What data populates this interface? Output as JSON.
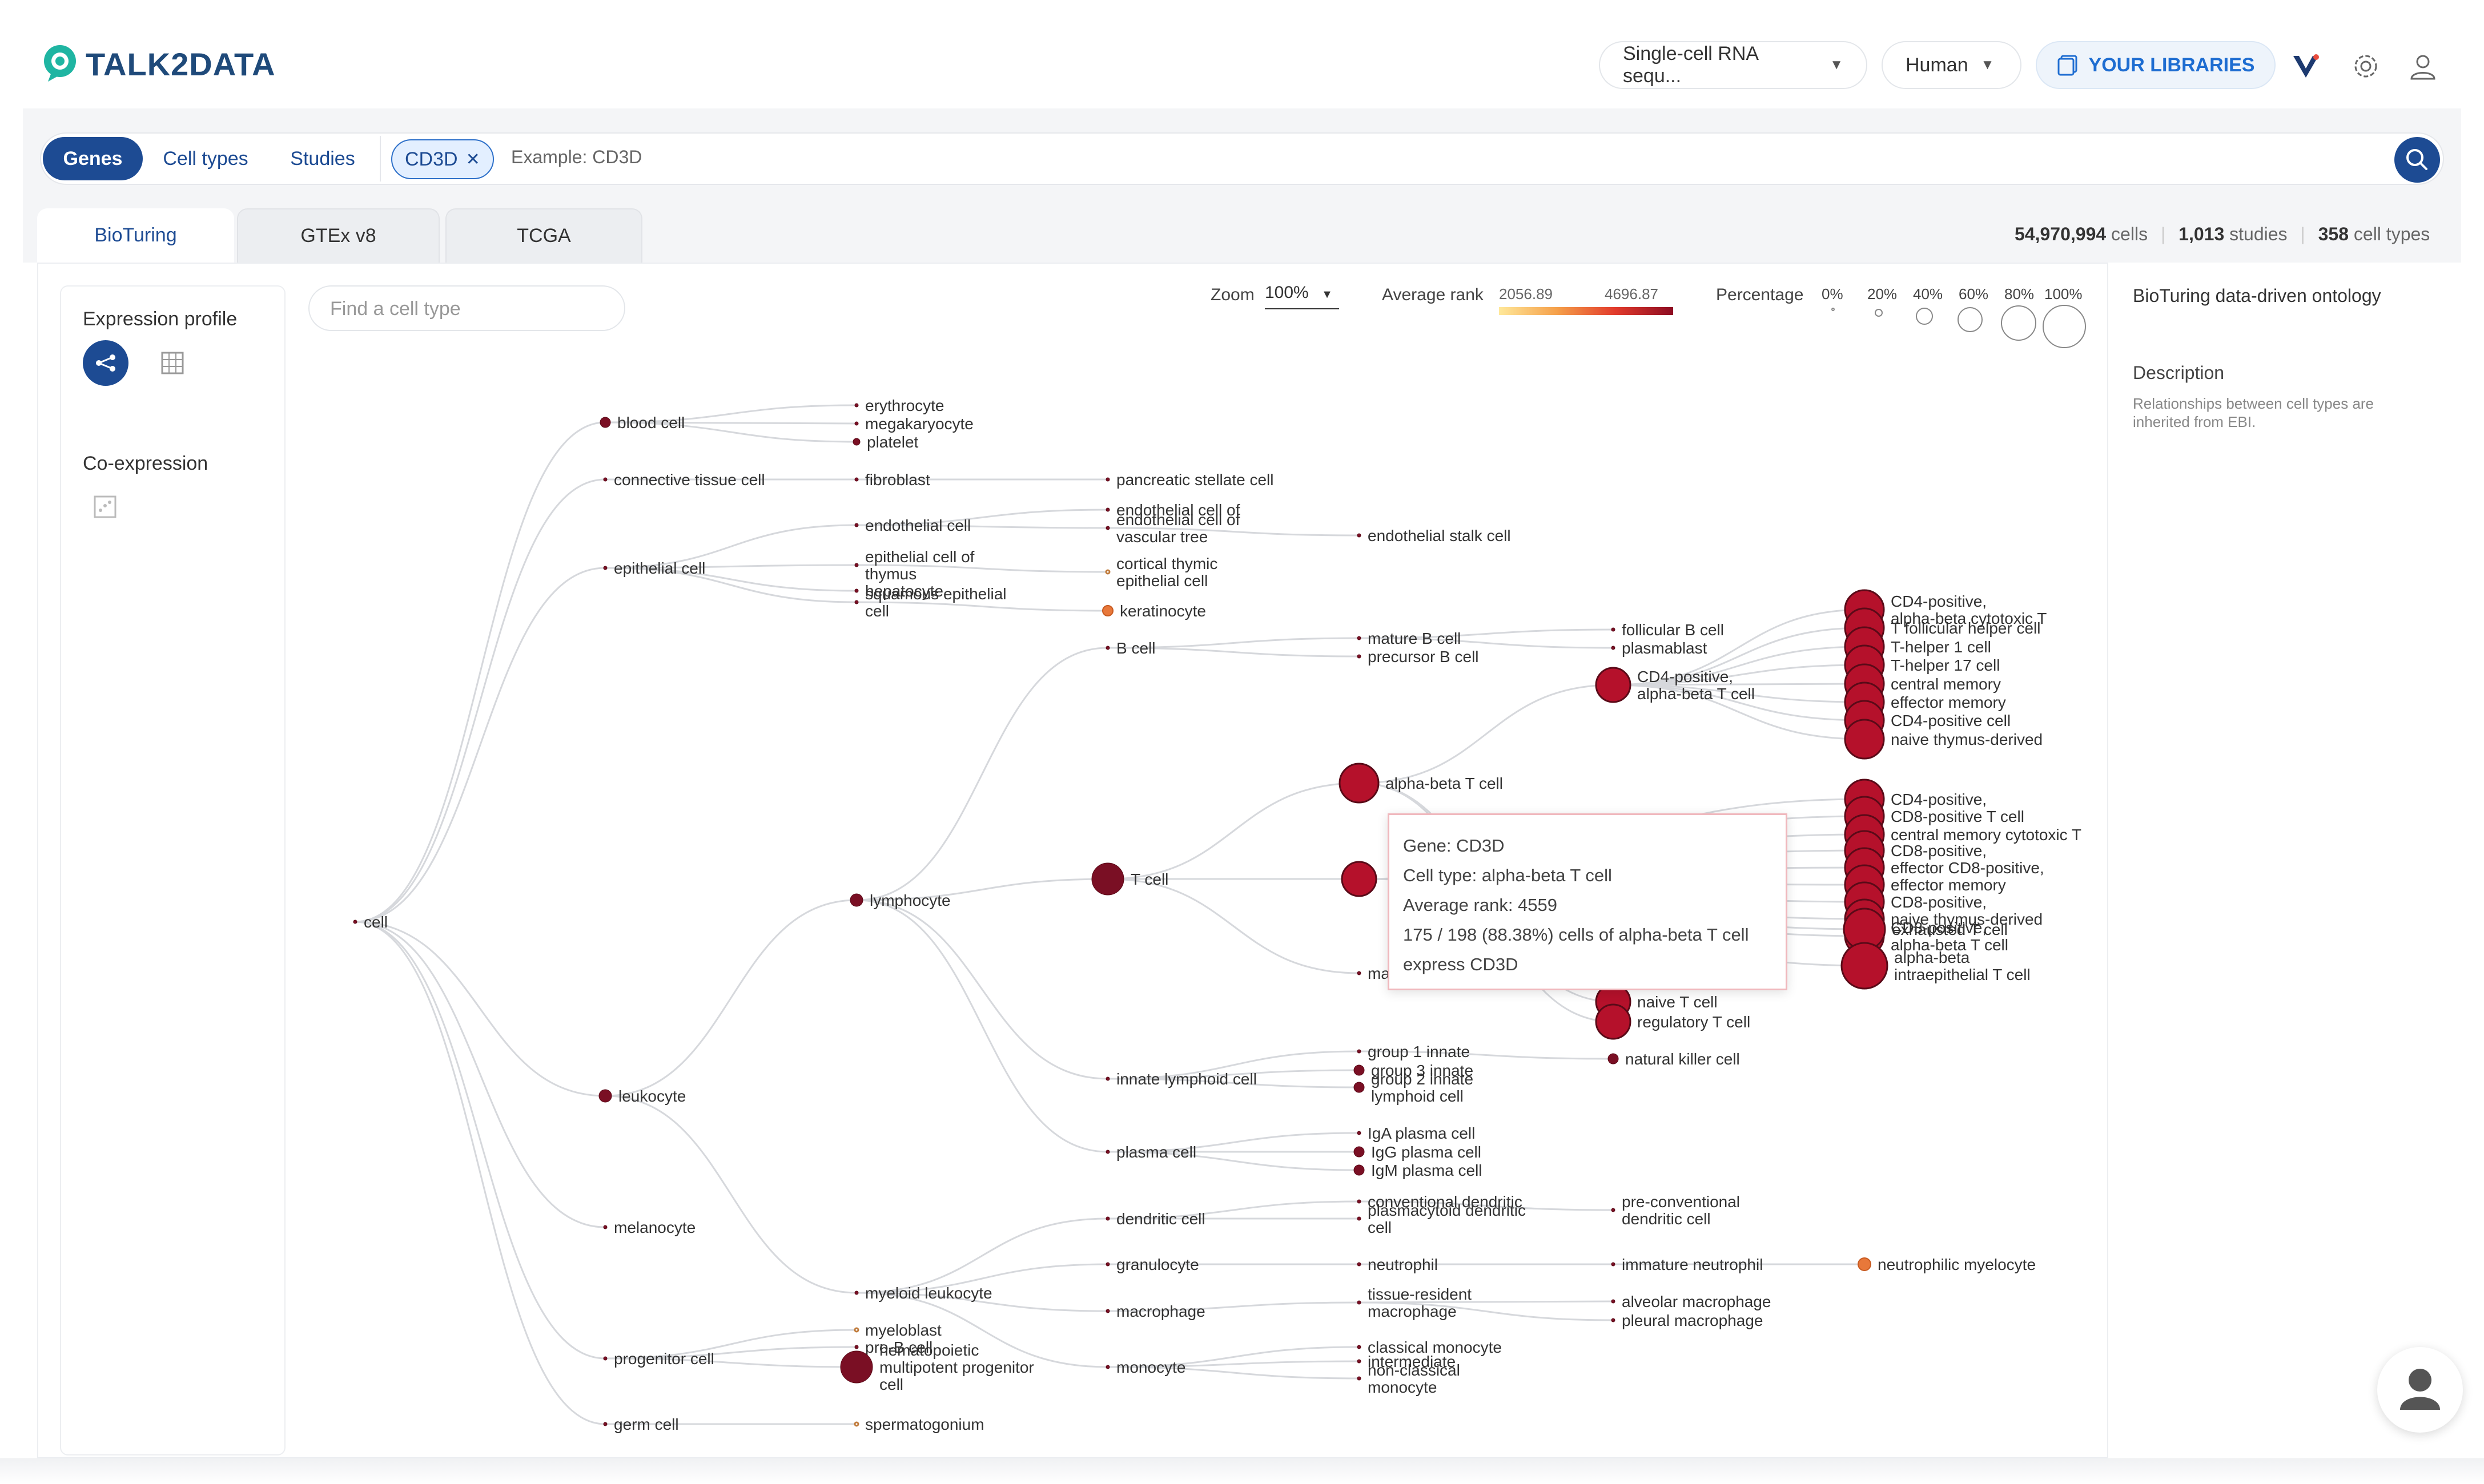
{
  "header": {
    "logo_text": "TALK2DATA",
    "dataset_select": "Single-cell RNA sequ...",
    "species_select": "Human",
    "libraries_label": "YOUR LIBRARIES"
  },
  "search": {
    "tabs": [
      "Genes",
      "Cell types",
      "Studies"
    ],
    "active_tab": "Genes",
    "chip": "CD3D",
    "placeholder": "Example: CD3D"
  },
  "source_tabs": [
    "BioTuring",
    "GTEx v8",
    "TCGA"
  ],
  "stats": {
    "cells": "54,970,994",
    "cells_label": "cells",
    "studies": "1,013",
    "studies_label": "studies",
    "cell_types": "358",
    "cell_types_label": "cell types"
  },
  "left_panel": {
    "expression_profile": "Expression profile",
    "co_expression": "Co-expression"
  },
  "tree_panel": {
    "find_placeholder": "Find a cell type",
    "zoom_label": "Zoom",
    "zoom_value": "100%",
    "avg_rank_label": "Average rank",
    "avg_rank_min": "2056.89",
    "avg_rank_max": "4696.87",
    "percentage_label": "Percentage",
    "percentage_ticks": [
      "0%",
      "20%",
      "40%",
      "60%",
      "80%",
      "100%"
    ]
  },
  "right_panel": {
    "title": "BioTuring data-driven ontology",
    "description_label": "Description",
    "description_line1": "Relationships between cell types are",
    "description_line2": "inherited from EBI."
  },
  "tooltip": {
    "gene": "Gene: CD3D",
    "cell_type": "Cell type: alpha-beta T cell",
    "avg_rank": "Average rank: 4559",
    "cells_line1": "175 / 198 (88.38%) cells of alpha-beta T cell",
    "cells_line2": "express CD3D"
  },
  "colors": {
    "brand_blue": "#1d4b93",
    "accent_teal": "#1fb5a2",
    "node_dark": "#7a0f24",
    "node_red": "#b5112b",
    "node_orange": "#e8783a"
  },
  "tree": {
    "nodes": [
      {
        "id": "cell",
        "labels": [
          "cell"
        ],
        "r": 3
      },
      {
        "id": "blood",
        "labels": [
          "blood cell"
        ],
        "r": 9
      },
      {
        "id": "conn",
        "labels": [
          "connective tissue cell"
        ],
        "r": 3
      },
      {
        "id": "epi",
        "labels": [
          "epithelial cell"
        ],
        "r": 3
      },
      {
        "id": "leuk",
        "labels": [
          "leukocyte"
        ],
        "r": 11
      },
      {
        "id": "mela",
        "labels": [
          "melanocyte"
        ],
        "r": 3
      },
      {
        "id": "prog",
        "labels": [
          "progenitor cell"
        ],
        "r": 3
      },
      {
        "id": "germ",
        "labels": [
          "germ cell"
        ],
        "r": 3
      },
      {
        "id": "ery",
        "labels": [
          "erythrocyte"
        ],
        "r": 3
      },
      {
        "id": "mega",
        "labels": [
          "megakaryocyte"
        ],
        "r": 3
      },
      {
        "id": "plt",
        "labels": [
          "platelet"
        ],
        "r": 6
      },
      {
        "id": "fib",
        "labels": [
          "fibroblast"
        ],
        "r": 3
      },
      {
        "id": "endo",
        "labels": [
          "endothelial cell"
        ],
        "r": 3
      },
      {
        "id": "epithy",
        "labels": [
          "epithelial cell of",
          "thymus"
        ],
        "r": 3
      },
      {
        "id": "hepa",
        "labels": [
          "hepatocyte"
        ],
        "r": 3
      },
      {
        "id": "squam",
        "labels": [
          "squamous epithelial",
          "cell"
        ],
        "r": 3
      },
      {
        "id": "lymph",
        "labels": [
          "lymphocyte"
        ],
        "r": 11
      },
      {
        "id": "myel",
        "labels": [
          "myeloid leukocyte"
        ],
        "r": 3
      },
      {
        "id": "myeloblast",
        "labels": [
          "myeloblast"
        ],
        "r": 3,
        "hollow": true
      },
      {
        "id": "prob",
        "labels": [
          "pro-B cell"
        ],
        "r": 3
      },
      {
        "id": "hema",
        "labels": [
          "hematopoietic",
          "multipotent progenitor",
          "cell"
        ],
        "r": 28
      },
      {
        "id": "sperm",
        "labels": [
          "spermatogonium"
        ],
        "r": 3,
        "hollow": true
      },
      {
        "id": "pancs",
        "labels": [
          "pancreatic stellate cell"
        ],
        "r": 3
      },
      {
        "id": "endoc",
        "labels": [
          "endothelial cell of"
        ],
        "r": 3
      },
      {
        "id": "endov",
        "labels": [
          "endothelial cell of",
          "vascular tree"
        ],
        "r": 3
      },
      {
        "id": "cortthy",
        "labels": [
          "cortical thymic",
          "epithelial cell"
        ],
        "r": 3,
        "hollow": true
      },
      {
        "id": "kera",
        "labels": [
          "keratinocyte"
        ],
        "r": 9,
        "orange": true
      },
      {
        "id": "bcell",
        "labels": [
          "B cell"
        ],
        "r": 3
      },
      {
        "id": "tcell",
        "labels": [
          "T cell"
        ],
        "r": 28
      },
      {
        "id": "ilc",
        "labels": [
          "innate lymphoid cell"
        ],
        "r": 3
      },
      {
        "id": "plasma",
        "labels": [
          "plasma cell"
        ],
        "r": 3
      },
      {
        "id": "dend",
        "labels": [
          "dendritic cell"
        ],
        "r": 3
      },
      {
        "id": "gran",
        "labels": [
          "granulocyte"
        ],
        "r": 3
      },
      {
        "id": "macro",
        "labels": [
          "macrophage"
        ],
        "r": 3
      },
      {
        "id": "mono",
        "labels": [
          "monocyte"
        ],
        "r": 3
      },
      {
        "id": "endostalk",
        "labels": [
          "endothelial stalk cell"
        ],
        "r": 3
      },
      {
        "id": "matb",
        "labels": [
          "mature B cell"
        ],
        "r": 3
      },
      {
        "id": "preb",
        "labels": [
          "precursor B cell"
        ],
        "r": 3
      },
      {
        "id": "abt",
        "labels": [
          "alpha-beta T cell"
        ],
        "r": 34
      },
      {
        "id": "gdt",
        "labels": [
          ""
        ],
        "r": 30
      },
      {
        "id": "mat",
        "labels": [
          "ma"
        ],
        "r": 3
      },
      {
        "id": "g1",
        "labels": [
          "group 1 innate"
        ],
        "r": 3
      },
      {
        "id": "g3",
        "labels": [
          "group 3 innate"
        ],
        "r": 9
      },
      {
        "id": "g2",
        "labels": [
          "group 2 innate",
          "lymphoid cell"
        ],
        "r": 9
      },
      {
        "id": "iga",
        "labels": [
          "IgA plasma cell"
        ],
        "r": 3
      },
      {
        "id": "igg",
        "labels": [
          "IgG plasma cell"
        ],
        "r": 9
      },
      {
        "id": "igm",
        "labels": [
          "IgM plasma cell"
        ],
        "r": 9
      },
      {
        "id": "convd",
        "labels": [
          "conventional dendritic"
        ],
        "r": 3
      },
      {
        "id": "plasd",
        "labels": [
          "plasmacytoid dendritic",
          "cell"
        ],
        "r": 3
      },
      {
        "id": "neut",
        "labels": [
          "neutrophil"
        ],
        "r": 3
      },
      {
        "id": "tisres",
        "labels": [
          "tissue-resident",
          "macrophage"
        ],
        "r": 3
      },
      {
        "id": "classm",
        "labels": [
          "classical monocyte"
        ],
        "r": 3
      },
      {
        "id": "intm",
        "labels": [
          "intermediate"
        ],
        "r": 3
      },
      {
        "id": "nonc",
        "labels": [
          "non-classical",
          "monocyte"
        ],
        "r": 3
      },
      {
        "id": "follb",
        "labels": [
          "follicular B cell"
        ],
        "r": 3
      },
      {
        "id": "plasmab",
        "labels": [
          "plasmablast"
        ],
        "r": 3
      },
      {
        "id": "cd4ab",
        "labels": [
          "CD4-positive,",
          "alpha-beta T cell"
        ],
        "r": 30
      },
      {
        "id": "naivet",
        "labels": [
          "naive T cell"
        ],
        "r": 30
      },
      {
        "id": "treg",
        "labels": [
          "regulatory T cell"
        ],
        "r": 30
      },
      {
        "id": "nk",
        "labels": [
          "natural killer cell"
        ],
        "r": 9
      },
      {
        "id": "preconv",
        "labels": [
          "pre-conventional",
          "dendritic cell"
        ],
        "r": 3
      },
      {
        "id": "immneut",
        "labels": [
          "immature neutrophil"
        ],
        "r": 3
      },
      {
        "id": "alvm",
        "labels": [
          "alveolar macrophage"
        ],
        "r": 3
      },
      {
        "id": "plm",
        "labels": [
          "pleural macrophage"
        ],
        "r": 3
      },
      {
        "id": "neutmye",
        "labels": [
          "neutrophilic myelocyte"
        ],
        "r": 11,
        "orange": true
      },
      {
        "id": "t1",
        "labels": [
          "CD4-positive,",
          "alpha-beta cytotoxic T"
        ],
        "r": 34
      },
      {
        "id": "t2",
        "labels": [
          "T follicular helper cell"
        ],
        "r": 34
      },
      {
        "id": "t3",
        "labels": [
          "T-helper 1 cell"
        ],
        "r": 34
      },
      {
        "id": "t4",
        "labels": [
          "T-helper 17 cell"
        ],
        "r": 34
      },
      {
        "id": "t5",
        "labels": [
          "central memory"
        ],
        "r": 34
      },
      {
        "id": "t6",
        "labels": [
          "effector memory"
        ],
        "r": 34
      },
      {
        "id": "t7",
        "labels": [
          "CD4-positive cell"
        ],
        "r": 34
      },
      {
        "id": "t8",
        "labels": [
          "naive thymus-derived"
        ],
        "r": 34
      },
      {
        "id": "t9",
        "labels": [
          "CD4-positive,"
        ],
        "r": 34
      },
      {
        "id": "t10",
        "labels": [
          "CD8-positive T cell"
        ],
        "r": 34
      },
      {
        "id": "t11",
        "labels": [
          "central memory cytotoxic T"
        ],
        "r": 34
      },
      {
        "id": "t12",
        "labels": [
          "CD8-positive,"
        ],
        "r": 34
      },
      {
        "id": "t13",
        "labels": [
          "effector CD8-positive,"
        ],
        "r": 34
      },
      {
        "id": "t14",
        "labels": [
          "effector memory"
        ],
        "r": 34
      },
      {
        "id": "t15",
        "labels": [
          "CD8-positive,"
        ],
        "r": 34
      },
      {
        "id": "t16",
        "labels": [
          "naive thymus-derived"
        ],
        "r": 34
      },
      {
        "id": "t17",
        "labels": [
          "CD8-positive,",
          "alpha-beta T cell"
        ],
        "r": 34
      },
      {
        "id": "exh",
        "labels": [
          "exhausted T cell"
        ],
        "r": 36
      },
      {
        "id": "iel",
        "labels": [
          "alpha-beta",
          "intraepithelial T cell"
        ],
        "r": 40
      }
    ],
    "edges": [
      [
        "cell",
        "blood"
      ],
      [
        "cell",
        "conn"
      ],
      [
        "cell",
        "epi"
      ],
      [
        "cell",
        "leuk"
      ],
      [
        "cell",
        "mela"
      ],
      [
        "cell",
        "prog"
      ],
      [
        "cell",
        "germ"
      ],
      [
        "blood",
        "ery"
      ],
      [
        "blood",
        "mega"
      ],
      [
        "blood",
        "plt"
      ],
      [
        "conn",
        "fib"
      ],
      [
        "epi",
        "endo"
      ],
      [
        "epi",
        "epithy"
      ],
      [
        "epi",
        "hepa"
      ],
      [
        "epi",
        "squam"
      ],
      [
        "leuk",
        "lymph"
      ],
      [
        "leuk",
        "myel"
      ],
      [
        "prog",
        "myeloblast"
      ],
      [
        "prog",
        "prob"
      ],
      [
        "prog",
        "hema"
      ],
      [
        "germ",
        "sperm"
      ],
      [
        "fib",
        "pancs"
      ],
      [
        "endo",
        "endoc"
      ],
      [
        "endo",
        "endov"
      ],
      [
        "epithy",
        "cortthy"
      ],
      [
        "squam",
        "kera"
      ],
      [
        "endov",
        "endostalk"
      ],
      [
        "lymph",
        "bcell"
      ],
      [
        "lymph",
        "tcell"
      ],
      [
        "lymph",
        "ilc"
      ],
      [
        "lymph",
        "plasma"
      ],
      [
        "myel",
        "dend"
      ],
      [
        "myel",
        "gran"
      ],
      [
        "myel",
        "macro"
      ],
      [
        "myel",
        "mono"
      ],
      [
        "bcell",
        "matb"
      ],
      [
        "bcell",
        "preb"
      ],
      [
        "matb",
        "follb"
      ],
      [
        "matb",
        "plasmab"
      ],
      [
        "tcell",
        "abt"
      ],
      [
        "tcell",
        "gdt"
      ],
      [
        "tcell",
        "mat"
      ],
      [
        "abt",
        "cd4ab"
      ],
      [
        "abt",
        "naivet"
      ],
      [
        "abt",
        "treg"
      ],
      [
        "ilc",
        "g1"
      ],
      [
        "ilc",
        "g3"
      ],
      [
        "ilc",
        "g2"
      ],
      [
        "g1",
        "nk"
      ],
      [
        "plasma",
        "iga"
      ],
      [
        "plasma",
        "igg"
      ],
      [
        "plasma",
        "igm"
      ],
      [
        "dend",
        "convd"
      ],
      [
        "dend",
        "plasd"
      ],
      [
        "convd",
        "preconv"
      ],
      [
        "gran",
        "neut"
      ],
      [
        "neut",
        "immneut"
      ],
      [
        "immneut",
        "neutmye"
      ],
      [
        "macro",
        "tisres"
      ],
      [
        "tisres",
        "alvm"
      ],
      [
        "tisres",
        "plm"
      ],
      [
        "mono",
        "classm"
      ],
      [
        "mono",
        "intm"
      ],
      [
        "mono",
        "nonc"
      ],
      [
        "cd4ab",
        "t1"
      ],
      [
        "cd4ab",
        "t2"
      ],
      [
        "cd4ab",
        "t3"
      ],
      [
        "cd4ab",
        "t4"
      ],
      [
        "cd4ab",
        "t5"
      ],
      [
        "cd4ab",
        "t6"
      ],
      [
        "cd4ab",
        "t7"
      ],
      [
        "cd4ab",
        "t8"
      ],
      [
        "gdt",
        "t9"
      ],
      [
        "gdt",
        "t10"
      ],
      [
        "gdt",
        "t11"
      ],
      [
        "gdt",
        "t12"
      ],
      [
        "gdt",
        "t13"
      ],
      [
        "gdt",
        "t14"
      ],
      [
        "gdt",
        "t15"
      ],
      [
        "gdt",
        "t16"
      ],
      [
        "gdt",
        "t17"
      ],
      [
        "gdt",
        "exh"
      ],
      [
        "gdt",
        "iel"
      ]
    ]
  }
}
